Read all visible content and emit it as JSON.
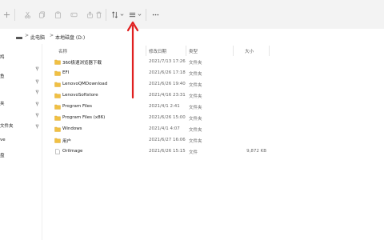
{
  "address": {
    "crumbs": [
      "此电脑",
      "本地磁盘 (D:)"
    ],
    "separator": ">"
  },
  "leftnav": {
    "fragments": [
      "鸠",
      "鱼",
      "夹",
      "文件夹",
      "ve",
      "盘"
    ]
  },
  "columns": {
    "name": "名称",
    "date": "修改日期",
    "type": "类型",
    "size": "大小"
  },
  "files": [
    {
      "name": "360极速浏览器下载",
      "date": "2021/7/13 17:26",
      "type": "文件夹",
      "size": "",
      "kind": "folder"
    },
    {
      "name": "EFI",
      "date": "2021/6/26 17:18",
      "type": "文件夹",
      "size": "",
      "kind": "folder"
    },
    {
      "name": "LenovoQMDownload",
      "date": "2021/6/26 19:40",
      "type": "文件夹",
      "size": "",
      "kind": "folder"
    },
    {
      "name": "LenovoSoftstore",
      "date": "2021/4/16 23:31",
      "type": "文件夹",
      "size": "",
      "kind": "folder"
    },
    {
      "name": "Program Files",
      "date": "2021/4/1 2:41",
      "type": "文件夹",
      "size": "",
      "kind": "folder"
    },
    {
      "name": "Program Files (x86)",
      "date": "2021/6/26 15:00",
      "type": "文件夹",
      "size": "",
      "kind": "folder"
    },
    {
      "name": "Windows",
      "date": "2021/4/1 4:07",
      "type": "文件夹",
      "size": "",
      "kind": "folder"
    },
    {
      "name": "用户",
      "date": "2021/6/27 16:06",
      "type": "文件夹",
      "size": "",
      "kind": "folder"
    },
    {
      "name": "OriImage",
      "date": "2021/6/26 15:15",
      "type": "文件",
      "size": "9,872 KB",
      "kind": "file"
    }
  ],
  "colors": {
    "folder": "#f0c043",
    "folder_dark": "#d9a52a",
    "accent_arrow": "#e02020",
    "toolbar_bg": "#f3f3f3"
  }
}
